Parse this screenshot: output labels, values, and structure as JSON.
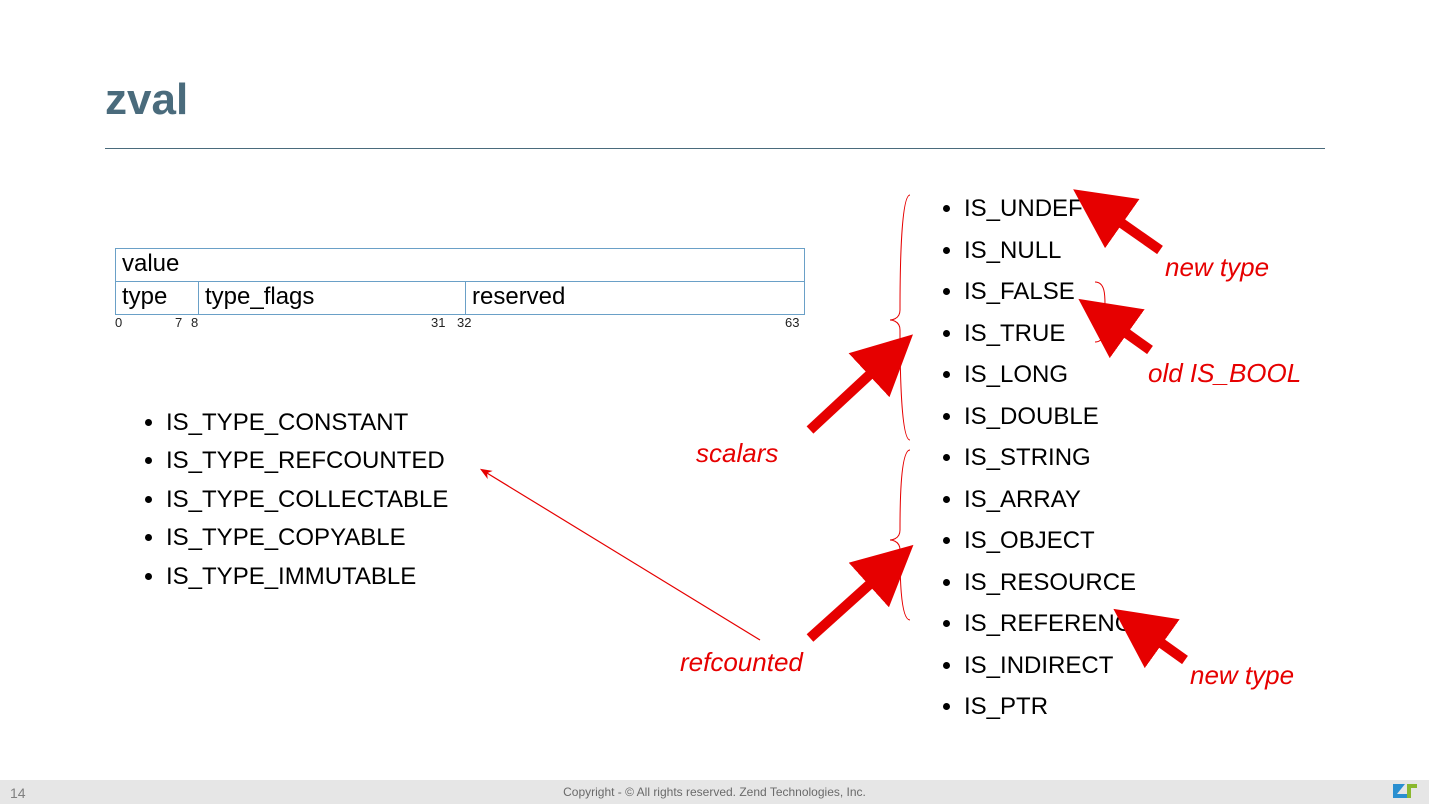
{
  "title": "zval",
  "struct": {
    "row1": "value",
    "row2": {
      "type": "type",
      "flags": "type_flags",
      "reserved": "reserved"
    },
    "bits": {
      "b0": "0",
      "b7": "7",
      "b8": "8",
      "b31": "31",
      "b32": "32",
      "b63": "63"
    }
  },
  "left_items": [
    "IS_TYPE_CONSTANT",
    "IS_TYPE_REFCOUNTED",
    "IS_TYPE_COLLECTABLE",
    "IS_TYPE_COPYABLE",
    "IS_TYPE_IMMUTABLE"
  ],
  "right_items": [
    "IS_UNDEF",
    "IS_NULL",
    "IS_FALSE",
    "IS_TRUE",
    "IS_LONG",
    "IS_DOUBLE",
    "IS_STRING",
    "IS_ARRAY",
    "IS_OBJECT",
    "IS_RESOURCE",
    "IS_REFERENCE",
    "IS_INDIRECT",
    "IS_PTR"
  ],
  "annotations": {
    "scalars": "scalars",
    "refcounted": "refcounted",
    "new_type_top": "new type",
    "old_is_bool": "old IS_BOOL",
    "new_type_bottom": "new type"
  },
  "footer": "Copyright - © All rights reserved. Zend Technologies, Inc.",
  "page": "14"
}
